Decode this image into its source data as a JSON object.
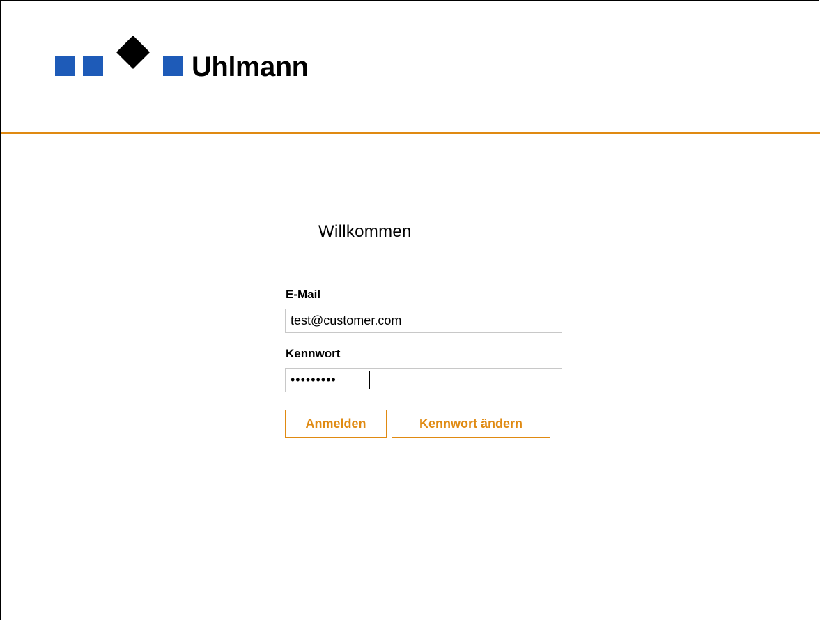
{
  "brand": {
    "name": "Uhlmann",
    "logo_square_color": "#1e5bb8",
    "logo_diamond_color": "#000000"
  },
  "colors": {
    "accent": "#e08a12",
    "rule": "#e08a12"
  },
  "login": {
    "title": "Willkommen",
    "email_label": "E-Mail",
    "email_value": "test@customer.com",
    "password_label": "Kennwort",
    "password_value": "•••••••••",
    "login_button": "Anmelden",
    "change_password_button": "Kennwort ändern"
  }
}
